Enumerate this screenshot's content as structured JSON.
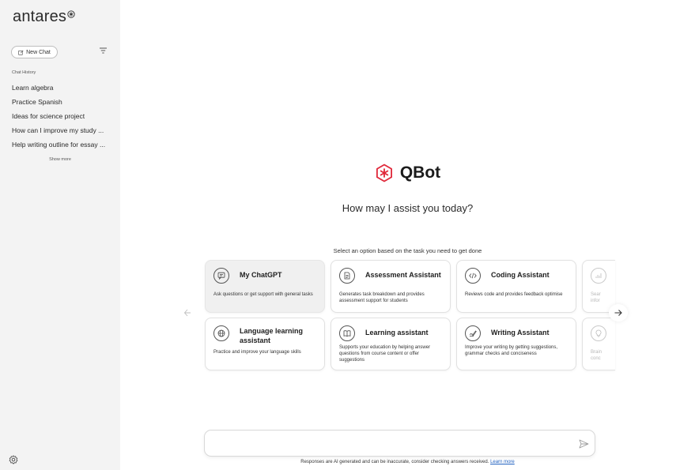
{
  "brand": {
    "name": "antares"
  },
  "sidebar": {
    "new_chat_label": "New Chat",
    "history_label": "Chat History",
    "history": [
      {
        "label": "Learn algebra"
      },
      {
        "label": "Practice Spanish"
      },
      {
        "label": "Ideas for science project"
      },
      {
        "label": "How can I improve my study ..."
      },
      {
        "label": "Help writing outline for essay ..."
      }
    ],
    "show_more_label": "Show more"
  },
  "main": {
    "bot_name": "QBot",
    "greeting": "How may I assist you today?",
    "select_hint": "Select an option based on the task you need to get done",
    "cards": [
      {
        "name": "My ChatGPT",
        "desc": "Ask questions or get support with general tasks",
        "icon": "chat-icon"
      },
      {
        "name": "Assessment Assistant",
        "desc": "Generates task breakdown and provides assessment support for students",
        "icon": "document-icon"
      },
      {
        "name": "Coding Assistant",
        "desc": "Reviews code and provides feedback optimise",
        "icon": "code-icon"
      },
      {
        "name": "Language learning assistant",
        "desc": "Practice and improve your language skills",
        "icon": "globe-icon"
      },
      {
        "name": "Learning assistant",
        "desc": "Supports your education by helping answer questions from course content or offer suggestions",
        "icon": "book-icon"
      },
      {
        "name": "Writing Assistant",
        "desc": "Improve your writing by getting suggestions, grammar checks and conciseness",
        "icon": "writing-icon"
      }
    ],
    "partial_cards": [
      {
        "desc": "Sear\ninfor",
        "icon": "chart-icon"
      },
      {
        "desc": "Brain\nconc",
        "icon": "lightbulb-icon"
      }
    ]
  },
  "composer": {
    "placeholder": "",
    "value": ""
  },
  "disclaimer": {
    "text": "Responses are AI generated and can be inaccurate, consider checking answers received. ",
    "link_label": "Learn more"
  },
  "colors": {
    "accent": "#e0283a",
    "sidebar_bg": "#f3f3f3",
    "active_card_bg": "#f0f0f0"
  }
}
